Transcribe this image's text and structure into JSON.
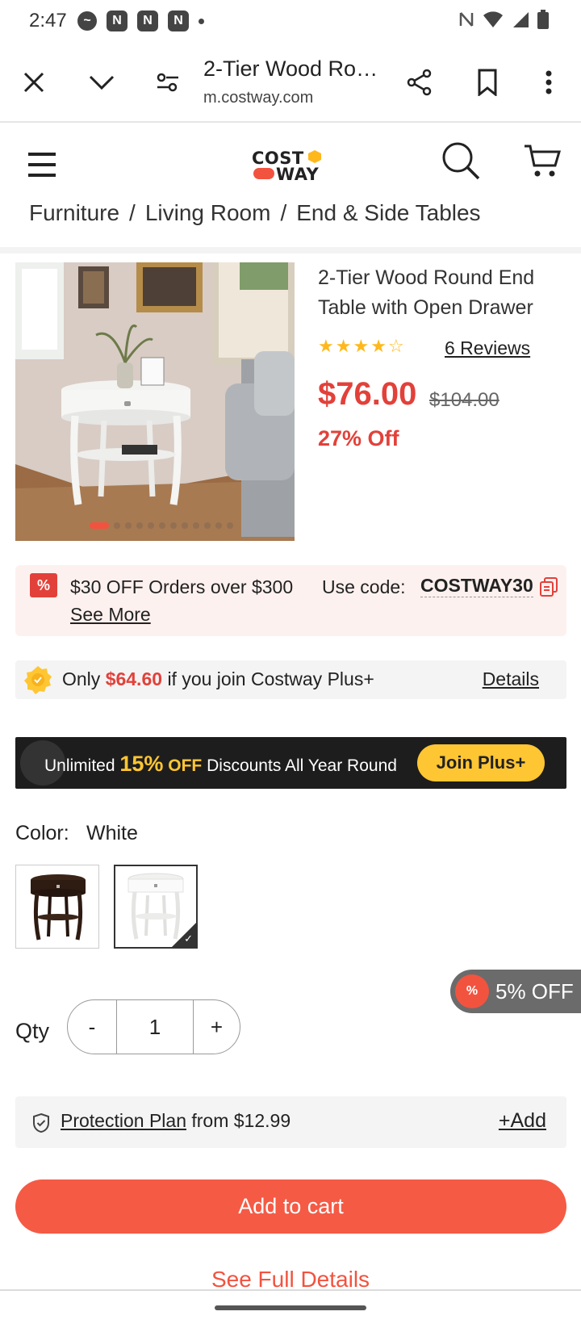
{
  "status_bar": {
    "time": "2:47"
  },
  "browser": {
    "tab_title": "2-Tier Wood Rou…",
    "url": "m.costway.com"
  },
  "site": {
    "logo_top": "COST",
    "logo_bottom": "WAY",
    "breadcrumb": [
      "Furniture",
      "Living Room",
      "End & Side Tables"
    ]
  },
  "product": {
    "title": "2-Tier Wood Round End Table with Open Drawer",
    "rating": 4.5,
    "reviews_label": "6 Reviews",
    "price": "$76.00",
    "original_price": "$104.00",
    "discount": "27% Off"
  },
  "promo": {
    "badge": "%",
    "text": "$30 OFF Orders over $300",
    "code_label": "Use code:",
    "code": "COSTWAY30",
    "see_more": "See More"
  },
  "plus": {
    "prefix": "Only",
    "price": "$64.60",
    "suffix": "if you join Costway Plus+",
    "details": "Details"
  },
  "banner": {
    "text_start": "Unlimited",
    "percent": "15%",
    "off": "OFF",
    "text_end": "Discounts All Year Round",
    "button": "Join Plus+"
  },
  "color": {
    "label": "Color:",
    "selected": "White",
    "options": [
      "Espresso",
      "White"
    ]
  },
  "float_badge": {
    "icon": "%",
    "text": "5% OFF"
  },
  "quantity": {
    "label": "Qty",
    "minus": "-",
    "value": "1",
    "plus": "+"
  },
  "protection": {
    "link": "Protection Plan",
    "text": "from $12.99",
    "add": "+Add"
  },
  "actions": {
    "add_to_cart": "Add to cart",
    "see_full_details": "See Full Details"
  },
  "colors": {
    "accent": "#f55a45",
    "price_red": "#e2413a",
    "plus_yellow": "#ffc633"
  }
}
